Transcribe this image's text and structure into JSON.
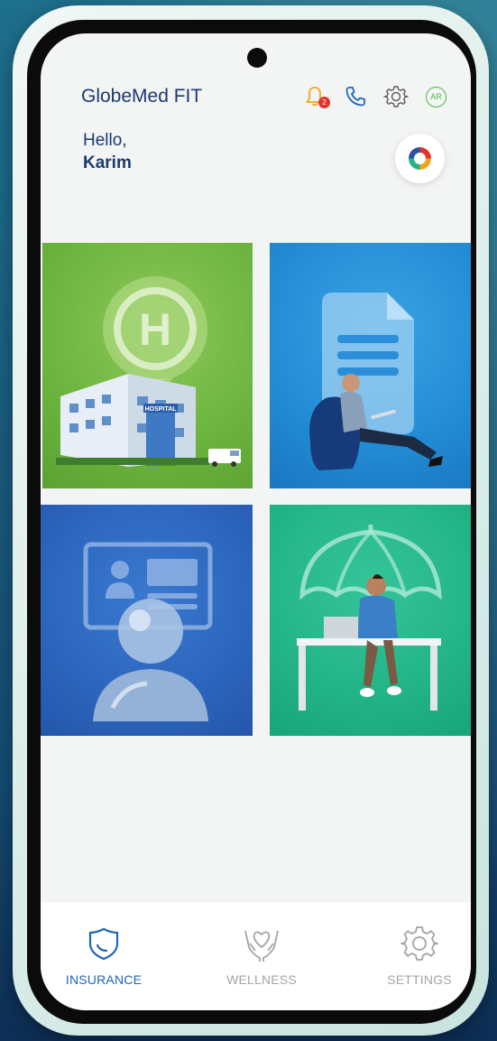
{
  "app": {
    "title": "GlobeMed FIT",
    "notification_count": "2",
    "language_toggle": "AR"
  },
  "greeting": {
    "hello": "Hello,",
    "name": "Karim"
  },
  "tiles": [
    {
      "icon": "hospital-icon"
    },
    {
      "icon": "document-icon"
    },
    {
      "icon": "id-card-icon"
    },
    {
      "icon": "umbrella-icon"
    }
  ],
  "bottom_nav": {
    "items": [
      {
        "label": "INSURANCE",
        "icon": "shield-icon",
        "active": true
      },
      {
        "label": "WELLNESS",
        "icon": "heart-hands-icon",
        "active": false
      },
      {
        "label": "SETTINGS",
        "icon": "gear-icon",
        "active": false
      }
    ]
  },
  "colors": {
    "brand": "#1b3a70",
    "accent_active": "#1b66b8",
    "inactive": "#a4a4a4",
    "bell": "#f2a51a",
    "phone": "#1b66b8",
    "badge": "#e4322b",
    "ar": "#4cb845",
    "tile_green": "#6eb541",
    "tile_blue": "#228bd5",
    "tile_navy": "#2c65bd",
    "tile_teal": "#22b486"
  }
}
